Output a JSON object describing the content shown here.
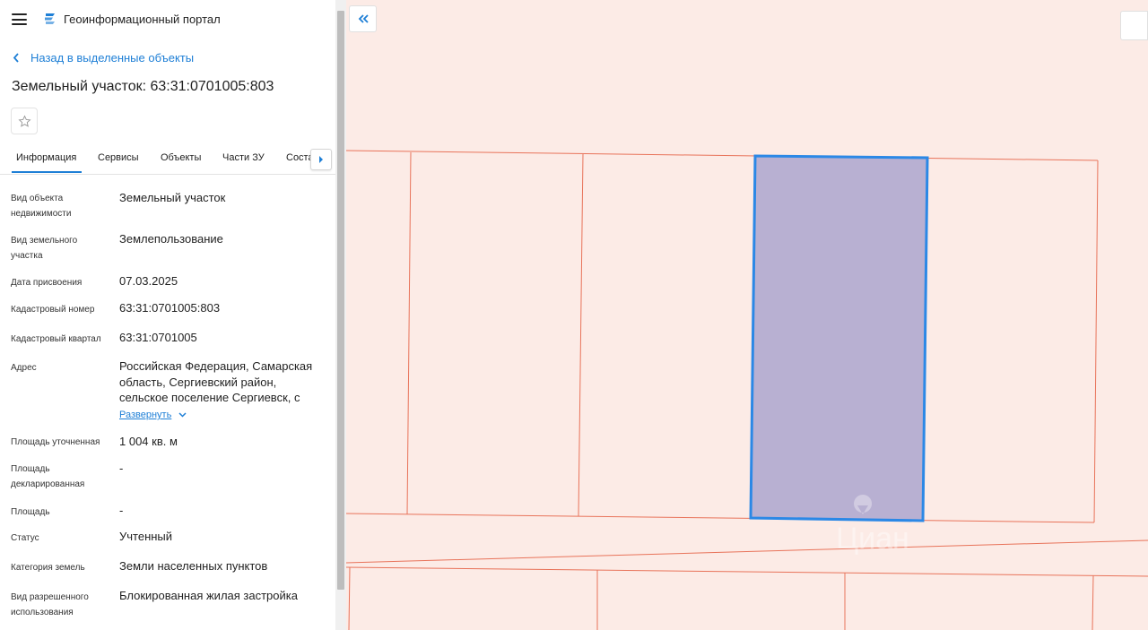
{
  "header": {
    "app_title": "Геоинформационный портал"
  },
  "nav": {
    "back_label": "Назад в выделенные объекты"
  },
  "object": {
    "title": "Земельный участок: 63:31:0701005:803"
  },
  "tabs": [
    {
      "label": "Информация"
    },
    {
      "label": "Сервисы"
    },
    {
      "label": "Объекты"
    },
    {
      "label": "Части ЗУ"
    },
    {
      "label": "Состав"
    }
  ],
  "properties": [
    {
      "label": "Вид объекта недвижимости",
      "value": "Земельный участок"
    },
    {
      "label": "Вид земельного участка",
      "value": "Землепользование"
    },
    {
      "label": "Дата присвоения",
      "value": "07.03.2025"
    },
    {
      "label": "Кадастровый номер",
      "value": "63:31:0701005:803"
    },
    {
      "label": "Кадастровый квартал",
      "value": "63:31:0701005"
    },
    {
      "label": "Адрес",
      "value": "Российская Федерация, Самарская область, Сергиевский район, сельское поселение Сергиевск, с"
    },
    {
      "label": "Площадь уточненная",
      "value": "1 004 кв. м"
    },
    {
      "label": "Площадь декларированная",
      "value": "-"
    },
    {
      "label": "Площадь",
      "value": "-"
    },
    {
      "label": "Статус",
      "value": "Учтенный"
    },
    {
      "label": "Категория земель",
      "value": "Земли населенных пунктов"
    },
    {
      "label": "Вид разрешенного использования",
      "value": "Блокированная жилая застройка"
    }
  ],
  "address_expand_label": "Развернуть",
  "map": {
    "watermark": "Циан"
  },
  "colors": {
    "accent": "#1e7fd6",
    "map_background": "#fcebe6",
    "parcel_border": "#e8735a",
    "selected_fill": "#b8b0d2",
    "selected_border": "#2b88e6"
  }
}
